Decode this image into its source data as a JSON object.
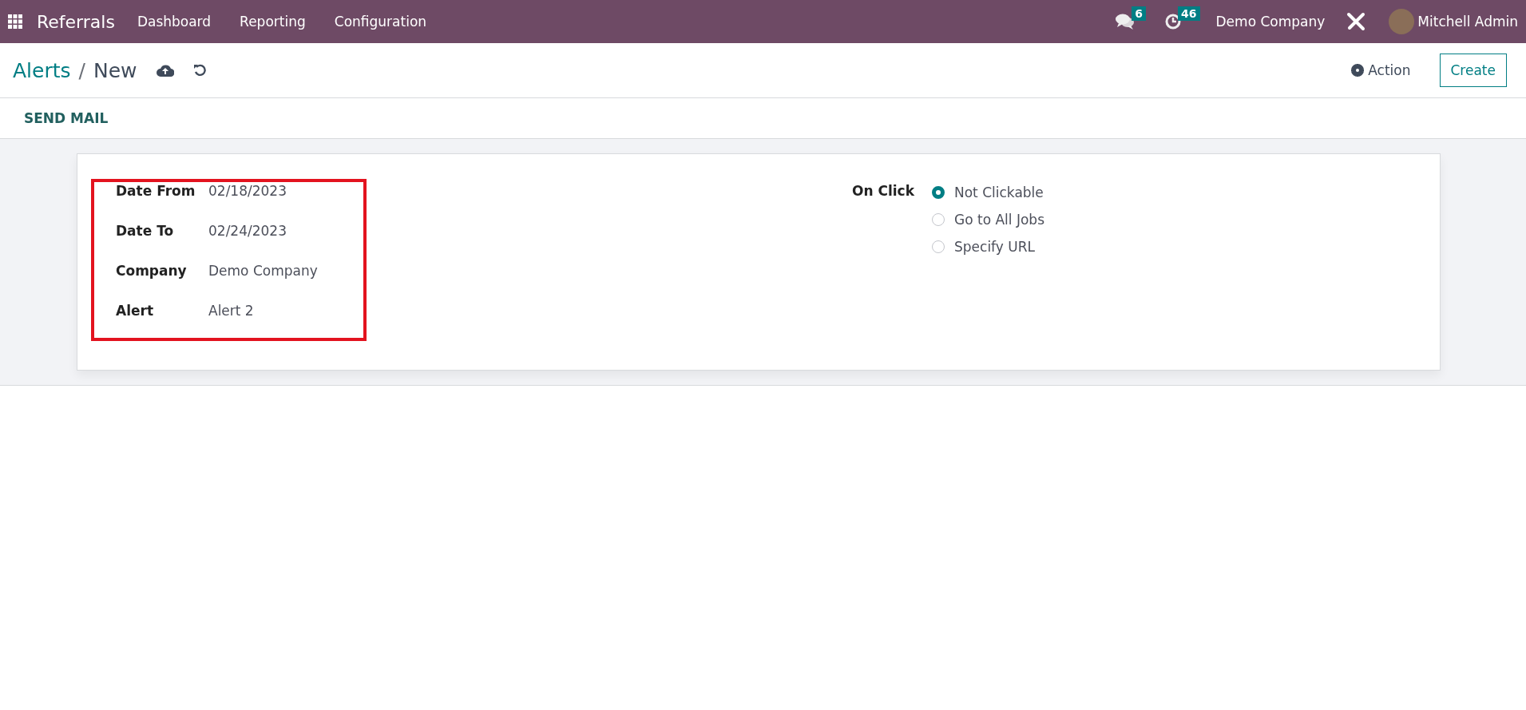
{
  "navbar": {
    "app_name": "Referrals",
    "menu": [
      "Dashboard",
      "Reporting",
      "Configuration"
    ],
    "messages_count": "6",
    "activities_count": "46",
    "company": "Demo Company",
    "user": "Mitchell Admin"
  },
  "breadcrumb": {
    "parent": "Alerts",
    "separator": "/",
    "current": "New"
  },
  "actions": {
    "action": "Action",
    "create": "Create"
  },
  "toolbar": {
    "send_mail": "SEND MAIL"
  },
  "form": {
    "fields": [
      {
        "label": "Date From",
        "value": "02/18/2023"
      },
      {
        "label": "Date To",
        "value": "02/24/2023"
      },
      {
        "label": "Company",
        "value": "Demo Company"
      },
      {
        "label": "Alert",
        "value": "Alert 2"
      }
    ],
    "on_click": {
      "label": "On Click",
      "options": [
        {
          "label": "Not Clickable",
          "selected": true
        },
        {
          "label": "Go to All Jobs",
          "selected": false
        },
        {
          "label": "Specify URL",
          "selected": false
        }
      ]
    }
  }
}
